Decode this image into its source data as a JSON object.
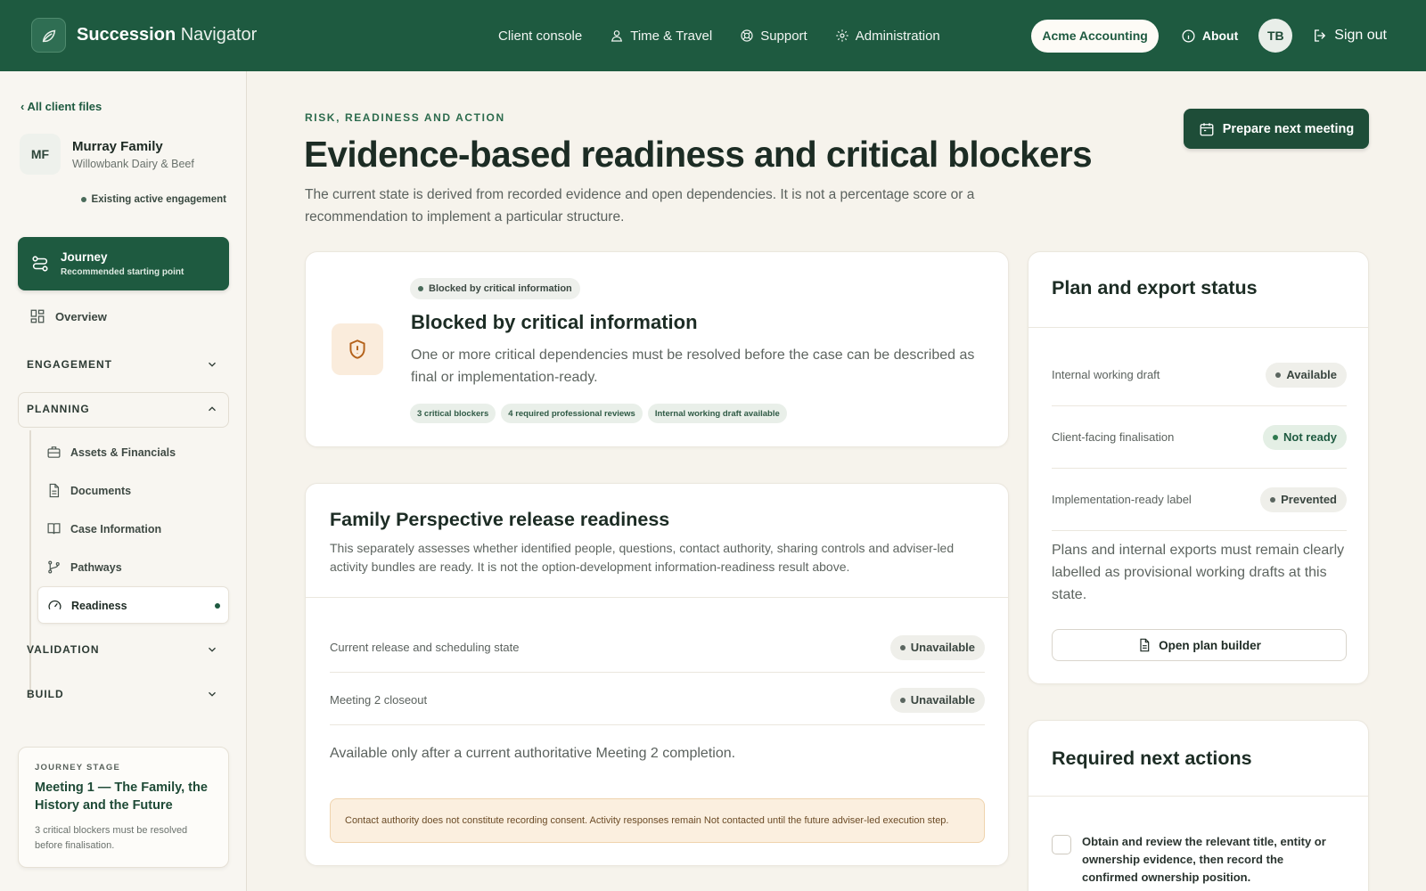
{
  "topbar": {
    "brand_bold": "Succession",
    "brand_light": "Navigator",
    "nav": [
      {
        "label": "Client console"
      },
      {
        "label": "Time & Travel"
      },
      {
        "label": "Support"
      },
      {
        "label": "Administration"
      }
    ],
    "org": "Acme Accounting",
    "about": "About",
    "user_initials": "TB",
    "sign_out": "Sign out",
    "brand_color": "#1e5a40"
  },
  "sidebar": {
    "back_link": "‹ All client files",
    "client_initials": "MF",
    "client_name": "Murray Family",
    "client_sub": "Willowbank Dairy & Beef",
    "engagement_status": "Existing active engagement",
    "journey_title": "Journey",
    "journey_sub": "Recommended starting point",
    "overview": "Overview",
    "sections": {
      "engagement": "ENGAGEMENT",
      "planning": "PLANNING",
      "validation": "VALIDATION",
      "build": "BUILD"
    },
    "planning_items": [
      {
        "label": "Assets & Financials",
        "icon": "briefcase-icon"
      },
      {
        "label": "Documents",
        "icon": "document-icon"
      },
      {
        "label": "Case Information",
        "icon": "book-icon"
      },
      {
        "label": "Pathways",
        "icon": "branch-icon"
      },
      {
        "label": "Readiness",
        "icon": "gauge-icon",
        "active": true
      }
    ],
    "stage": {
      "label": "JOURNEY STAGE",
      "title": "Meeting 1 — The Family, the History and the Future",
      "note": "3 critical blockers must be resolved before finalisation."
    }
  },
  "main": {
    "eyebrow": "RISK, READINESS AND ACTION",
    "title": "Evidence-based readiness and critical blockers",
    "intro": "The current state is derived from recorded evidence and open dependencies. It is not a percentage score or a recommendation to implement a particular structure.",
    "prepare_button": "Prepare next meeting",
    "blocked": {
      "chip": "Blocked by critical information",
      "title": "Blocked by critical information",
      "desc": "One or more critical dependencies must be resolved before the case can be described as final or implementation-ready.",
      "tags": [
        "3 critical blockers",
        "4 required professional reviews",
        "Internal working draft available"
      ]
    },
    "family": {
      "title": "Family Perspective release readiness",
      "desc": "This separately assesses whether identified people, questions, contact authority, sharing controls and adviser-led activity bundles are ready. It is not the option-development information-readiness result above.",
      "rows": [
        {
          "label": "Current release and scheduling state",
          "status": "Unavailable"
        },
        {
          "label": "Meeting 2 closeout",
          "status": "Unavailable"
        }
      ],
      "note": "Available only after a current authoritative Meeting 2 completion.",
      "consent": "Contact authority does not constitute recording consent. Activity responses remain Not contacted until the future adviser-led execution step."
    },
    "plan": {
      "title": "Plan and export status",
      "rows": [
        {
          "label": "Internal working draft",
          "status": "Available",
          "tone": "grey"
        },
        {
          "label": "Client-facing finalisation",
          "status": "Not ready",
          "tone": "green"
        },
        {
          "label": "Implementation-ready label",
          "status": "Prevented",
          "tone": "grey"
        }
      ],
      "note": "Plans and internal exports must remain clearly labelled as provisional working drafts at this state.",
      "button": "Open plan builder"
    },
    "actions": {
      "title": "Required next actions",
      "items": [
        {
          "text": "Obtain and review the relevant title, entity or ownership evidence, then record the confirmed ownership position.",
          "checked": false
        }
      ]
    }
  }
}
